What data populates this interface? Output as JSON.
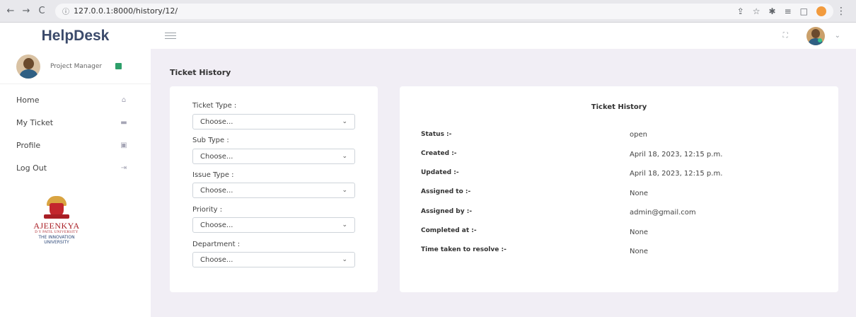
{
  "browser": {
    "back": "←",
    "forward": "→",
    "reload": "C",
    "url": "127.0.0.1:8000/history/12/"
  },
  "app": {
    "brand": "HelpDesk"
  },
  "sidebar": {
    "role": "Project Manager",
    "items": [
      {
        "label": "Home",
        "icon": "home-icon"
      },
      {
        "label": "My Ticket",
        "icon": "ticket-icon"
      },
      {
        "label": "Profile",
        "icon": "profile-icon"
      },
      {
        "label": "Log Out",
        "icon": "logout-icon"
      }
    ],
    "logo": {
      "name": "AJEENKYA",
      "sub": "D Y PATIL UNIVERSITY",
      "tag1": "THE INNOVATION",
      "tag2": "UNIVERSITY"
    }
  },
  "main": {
    "page_title": "Ticket History"
  },
  "filters": [
    {
      "label": "Ticket Type :",
      "value": "Choose..."
    },
    {
      "label": "Sub Type :",
      "value": "Choose..."
    },
    {
      "label": "Issue Type :",
      "value": "Choose..."
    },
    {
      "label": "Priority :",
      "value": "Choose..."
    },
    {
      "label": "Department :",
      "value": "Choose..."
    }
  ],
  "history": {
    "title": "Ticket History",
    "rows": [
      {
        "label": "Status :-",
        "value": "open"
      },
      {
        "label": "Created :-",
        "value": "April 18, 2023, 12:15 p.m."
      },
      {
        "label": "Updated :-",
        "value": "April 18, 2023, 12:15 p.m."
      },
      {
        "label": "Assigned to :-",
        "value": "None"
      },
      {
        "label": "Assigned by :-",
        "value": "admin@gmail.com"
      },
      {
        "label": "Completed at :-",
        "value": "None"
      },
      {
        "label": "Time taken to resolve :-",
        "value": "None"
      }
    ]
  }
}
